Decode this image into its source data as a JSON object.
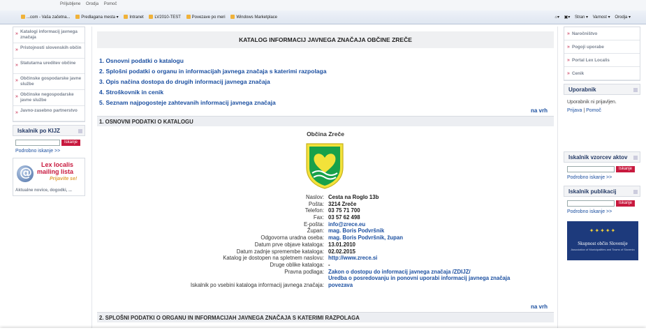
{
  "browser": {
    "menu": [
      "Priljubljene",
      "Orodja",
      "Pomoč"
    ],
    "favorites": [
      "...com - Vaša začetna...",
      "Predlagana mesta ▾",
      "Intranet",
      "LV2010-TEST",
      "Povezave po meri",
      "Windows Marketplace"
    ],
    "tools": [
      "▾",
      "▾",
      "Stran ▾",
      "Varnost ▾",
      "Orodja ▾"
    ]
  },
  "left": {
    "nav": [
      "Katalogi informacij javnega značaja",
      "Pristojnosti slovenskih občin",
      "Statutarna ureditev občine",
      "Občinske gospodarske javne službe",
      "Občinske negospodarske javne službe",
      "Javno-zasebno partnerstvo"
    ],
    "search_title": "Iskalnik po KIJZ",
    "search_button": "Iskanje",
    "advanced": "Podrobno iskanje >>",
    "lex": {
      "line1": "Lex localis",
      "line2": "mailing lista",
      "line3": "Prijavite se!",
      "line4": "Aktualne novice, dogodki, ..."
    }
  },
  "main": {
    "title": "KATALOG INFORMACIJ JAVNEGA ZNAČAJA OBČINE ZREČE",
    "toc": [
      "1. Osnovni podatki o katalogu",
      "2. Splošni podatki o organu in informacijah javnega značaja s katerimi razpolaga",
      "3. Opis načina dostopa do drugih informacij javnega značaja",
      "4. Stroškovnik in cenik",
      "5. Seznam najpogosteje zahtevanih informacij javnega značaja"
    ],
    "to_top": "na vrh",
    "section1": "1. OSNOVNI PODATKI O KATALOGU",
    "municipality": "Občina  Zreče",
    "details": [
      {
        "k": "Naslov:",
        "v": "Cesta na Roglo 13b",
        "link": false
      },
      {
        "k": "Pošta:",
        "v": "3214 Zreče",
        "link": false
      },
      {
        "k": "Telefon:",
        "v": "03 75 71 700",
        "link": false
      },
      {
        "k": "Fax:",
        "v": "03 57 62 498",
        "link": false
      },
      {
        "k": "E-pošta:",
        "v": "info@zrece.eu",
        "link": true
      },
      {
        "k": "Župan:",
        "v": "mag. Boris Podvršnik",
        "link": true
      },
      {
        "k": "Odgovorna uradna oseba:",
        "v": "mag. Boris Podvršnik, župan",
        "link": true
      },
      {
        "k": "Datum prve objave kataloga:",
        "v": "13.01.2010",
        "link": false
      },
      {
        "k": "Datum zadnje spremembe kataloga:",
        "v": "02.02.2015",
        "link": false
      },
      {
        "k": "Katalog je dostopen na spletnem naslovu:",
        "v": "http://www.zrece.si",
        "link": true
      },
      {
        "k": "Druge oblike kataloga:",
        "v": "-",
        "link": false
      },
      {
        "k": "Pravna podlaga:",
        "v": "Zakon o dostopu do informacij javnega značaja /ZDIJZ/",
        "link": true
      },
      {
        "k": "",
        "v": "Uredba o posredovanju in ponovni uporabi informacij javnega značaja",
        "link": true
      },
      {
        "k": "Iskalnik po vsebini kataloga informacij javnega značaja:",
        "v": "povezava",
        "link": true
      }
    ],
    "section2": "2. SPLOŠNI PODATKI O ORGANU IN INFORMACIJAH JAVNEGA ZNAČAJA S KATERIMI RAZPOLAGA"
  },
  "right": {
    "nav": [
      "Naročništvo",
      "Pogoji uporabe",
      "Portal Lex Localis",
      "Cenik"
    ],
    "user_title": "Uporabnik",
    "user_status": "Uporabnik ni prijavljen.",
    "login": "Prijava",
    "sep": "|",
    "help": "Pomoč",
    "search_acts_title": "Iskalnik vzorcev aktov",
    "search_pub_title": "Iskalnik publikacij",
    "search_button": "Iskanje",
    "advanced": "Podrobno iskanje >>",
    "eu_line1": "Skupnost občin Slovenije",
    "eu_line2": "Association of Municipalities and Towns of Slovenia"
  },
  "colors": {
    "accent": "#c8193e",
    "link": "#1b4fa0",
    "crest_green": "#18a14a",
    "crest_yellow": "#f2e23a"
  }
}
